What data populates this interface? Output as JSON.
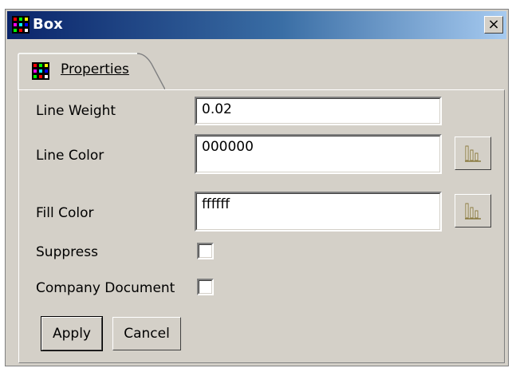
{
  "window": {
    "title": "Box",
    "close_glyph": "×"
  },
  "tabs": [
    {
      "label": "Properties",
      "icon": "grid-icon",
      "active": true
    }
  ],
  "form": {
    "line_weight": {
      "label": "Line Weight",
      "value": "0.02"
    },
    "line_color": {
      "label": "Line Color",
      "value": "000000",
      "picker_icon": "color-picker-icon"
    },
    "fill_color": {
      "label": "Fill Color",
      "value": "ffffff",
      "picker_icon": "color-picker-icon"
    },
    "suppress": {
      "label": "Suppress",
      "checked": false
    },
    "company_document": {
      "label": "Company Document",
      "checked": false
    }
  },
  "buttons": {
    "apply": "Apply",
    "cancel": "Cancel"
  },
  "colors": {
    "titlebar_start": "#0a246a",
    "titlebar_end": "#a6caf0",
    "face": "#d4d0c8"
  }
}
